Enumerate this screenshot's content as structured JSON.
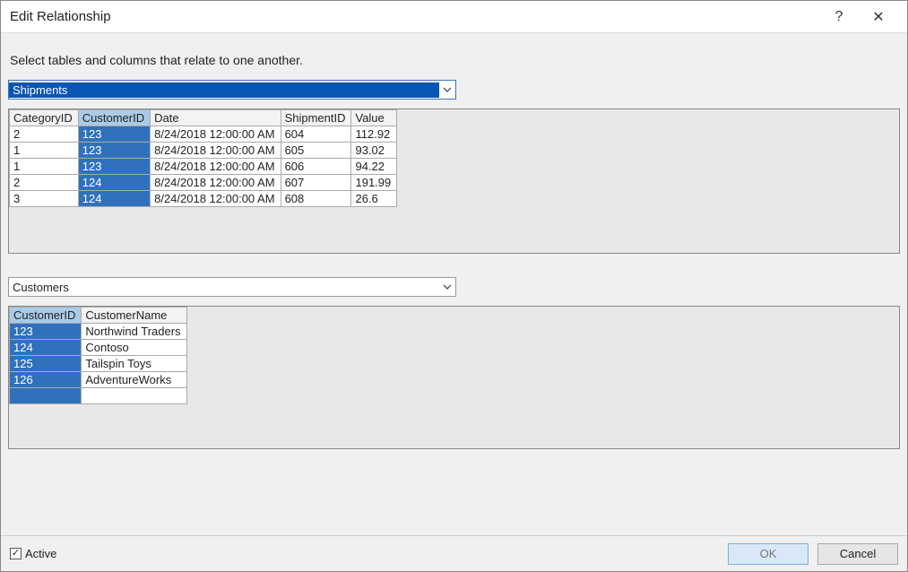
{
  "title": "Edit Relationship",
  "help_symbol": "?",
  "close_symbol": "✕",
  "instruction": "Select tables and columns that relate to one another.",
  "combo1": {
    "text": "Shipments"
  },
  "combo2": {
    "text": "Customers"
  },
  "table1": {
    "headers": {
      "c0": "CategoryID",
      "c1": "CustomerID",
      "c2": "Date",
      "c3": "ShipmentID",
      "c4": "Value"
    },
    "key_column_index": 1,
    "rows": [
      {
        "c0": "2",
        "c1": "123",
        "c2": "8/24/2018 12:00:00 AM",
        "c3": "604",
        "c4": "112.92"
      },
      {
        "c0": "1",
        "c1": "123",
        "c2": "8/24/2018 12:00:00 AM",
        "c3": "605",
        "c4": "93.02"
      },
      {
        "c0": "1",
        "c1": "123",
        "c2": "8/24/2018 12:00:00 AM",
        "c3": "606",
        "c4": "94.22"
      },
      {
        "c0": "2",
        "c1": "124",
        "c2": "8/24/2018 12:00:00 AM",
        "c3": "607",
        "c4": "191.99"
      },
      {
        "c0": "3",
        "c1": "124",
        "c2": "8/24/2018 12:00:00 AM",
        "c3": "608",
        "c4": "26.6"
      }
    ]
  },
  "table2": {
    "headers": {
      "c0": "CustomerID",
      "c1": "CustomerName"
    },
    "key_column_index": 0,
    "rows": [
      {
        "c0": "123",
        "c1": "Northwind Traders"
      },
      {
        "c0": "124",
        "c1": "Contoso"
      },
      {
        "c0": "125",
        "c1": "Tailspin Toys"
      },
      {
        "c0": "126",
        "c1": "AdventureWorks"
      },
      {
        "c0": "",
        "c1": ""
      }
    ]
  },
  "footer": {
    "active_label": "Active",
    "active_checked": true,
    "ok_label": "OK",
    "cancel_label": "Cancel"
  }
}
